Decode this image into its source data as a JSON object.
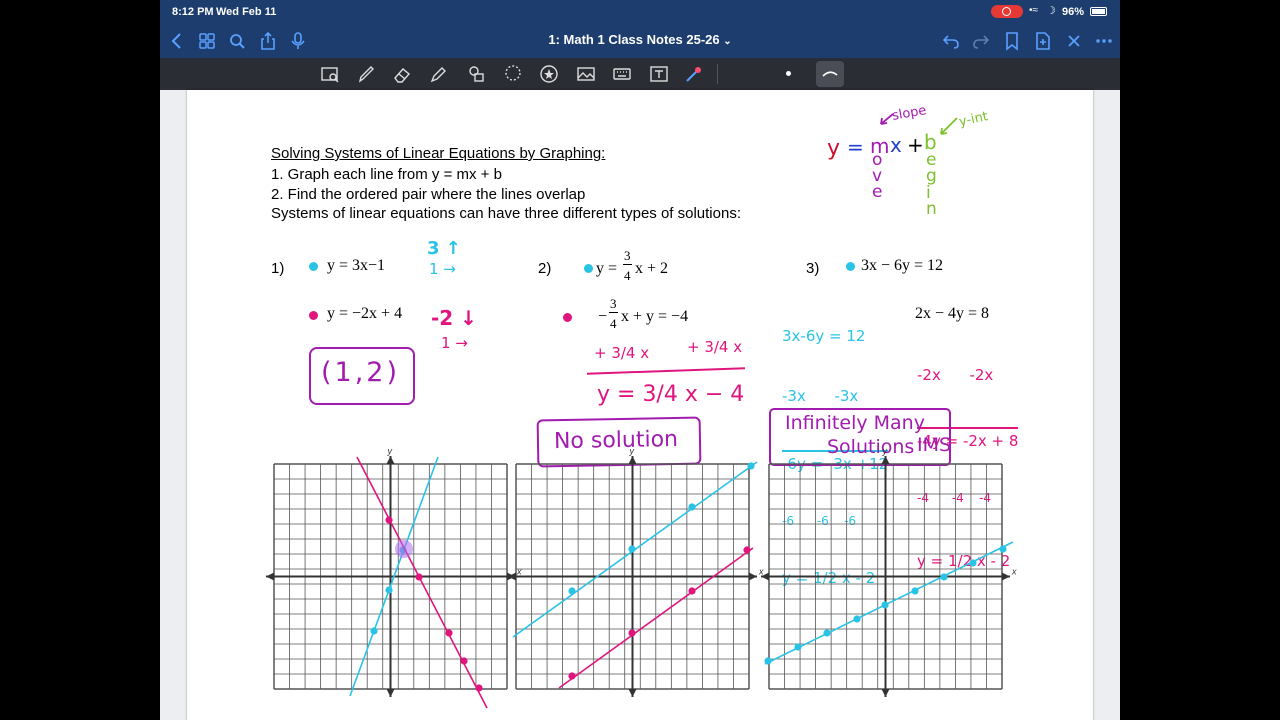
{
  "status": {
    "time": "8:12 PM",
    "date": "Wed Feb 11",
    "battery": "96%"
  },
  "nav": {
    "title": "1: Math 1 Class Notes 25-26"
  },
  "toolbar": {
    "items": [
      "text-scan-icon",
      "pen-icon",
      "eraser-icon",
      "highlighter-icon",
      "shapes-icon",
      "lasso-icon",
      "sticker-icon",
      "image-icon",
      "keyboard-icon",
      "text-box-icon",
      "laser-pointer-icon"
    ]
  },
  "notes": {
    "heading": "Solving Systems of Linear Equations by Graphing:",
    "step1": "1. Graph each line from y = mx + b",
    "step2": "2. Find the ordered pair where the lines overlap",
    "types": "Systems of linear equations can have three different types of solutions:"
  },
  "slope_intercept": {
    "y": "y",
    "eq": "=",
    "m": "m",
    "x": "x",
    "plus": "+",
    "b": "b",
    "slope": "slope",
    "yint": "y-int",
    "move": [
      "o",
      "v",
      "e"
    ],
    "begin": [
      "e",
      "g",
      "i",
      "n"
    ]
  },
  "problems": {
    "p1": {
      "num": "1)",
      "eq1": "y = 3x−1",
      "eq2": "y = −2x + 4",
      "note1_top": "3 ↑",
      "note1_bot": "1 →",
      "note2_top": "-2 ↓",
      "note2_bot": "1 →",
      "answer": "(1,2)"
    },
    "p2": {
      "num": "2)",
      "eq1_pre": "y =",
      "eq1_frac_num": "3",
      "eq1_frac_den": "4",
      "eq1_post": "x + 2",
      "eq2_pre": "−",
      "eq2_frac_num": "3",
      "eq2_frac_den": "4",
      "eq2_post": "x + y = −4",
      "work1": "+ 3/4 x",
      "work2": "+ 3/4 x",
      "work3": "y = 3/4 x − 4",
      "answer": "No solution"
    },
    "p3": {
      "num": "3)",
      "eq1": "3x − 6y = 12",
      "eq2": "2x − 4y = 8",
      "work_left": [
        "3x-6y = 12",
        "-3x      -3x",
        "-6y = -3x +12",
        "-6      -6    -6",
        "y = 1/2 x - 2"
      ],
      "work_right": [
        "-2x      -2x",
        "-4y = -2x + 8",
        "-4      -4    -4",
        "y = 1/2 x - 2"
      ],
      "answer_line1": "Infinitely Many",
      "answer_line2": "Solutions",
      "answer_abbr": "IMS"
    }
  },
  "graphs": {
    "axis_x": "x",
    "axis_y": "y"
  },
  "colors": {
    "cyan": "#29c3e6",
    "magenta": "#e0157e",
    "purple": "#a21caf",
    "green": "#7cc22a",
    "red": "#c8102e",
    "blue": "#1e3fd1",
    "violet": "#b06cf0"
  }
}
